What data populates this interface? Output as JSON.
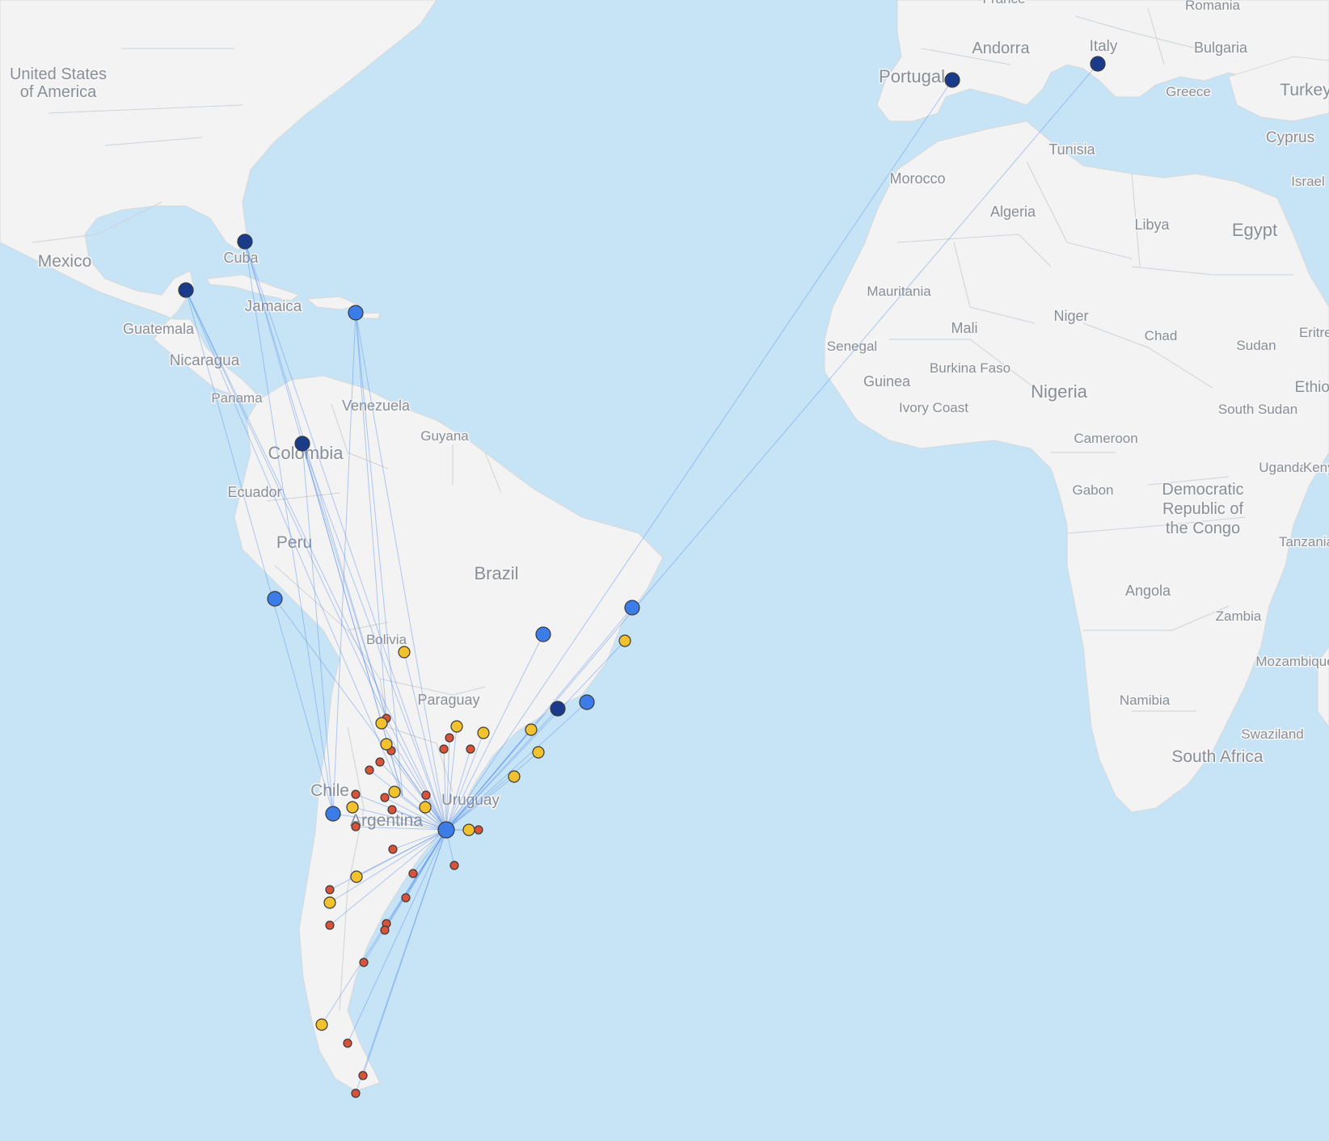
{
  "colors": {
    "ocean": "#c6e4f6",
    "land": "#f3f3f3",
    "route": "#5b8ee8",
    "navy_marker": "#1a3a8a",
    "blue_marker": "#3b7ce8",
    "yellow_marker": "#f2c12e",
    "red_marker": "#d9533b"
  },
  "map": {
    "labels": [
      "United States",
      "of America",
      "Mexico",
      "Cuba",
      "Jamaica",
      "Guatemala",
      "Nicaragua",
      "Panama",
      "Venezuela",
      "Guyana",
      "Colombia",
      "Ecuador",
      "Peru",
      "Brazil",
      "Bolivia",
      "Paraguay",
      "Chile",
      "Uruguay",
      "Argentina",
      "France",
      "Romania",
      "Andorra",
      "Italy",
      "Bulgaria",
      "Portugal",
      "Greece",
      "Turkey",
      "Cyprus",
      "Israel",
      "Tunisia",
      "Morocco",
      "Algeria",
      "Libya",
      "Egypt",
      "Mauritania",
      "Mali",
      "Niger",
      "Chad",
      "Sudan",
      "Senegal",
      "Burkina Faso",
      "Guinea",
      "Ivory Coast",
      "Nigeria",
      "South Sudan",
      "Cameroon",
      "Gabon",
      "Uganda",
      "Democratic",
      "Republic of",
      "the Congo",
      "Tanzania",
      "Angola",
      "Zambia",
      "Mozambique",
      "Namibia",
      "Swaziland",
      "South Africa",
      "Kenya",
      "Eritrea",
      "Ethiopia"
    ]
  },
  "markers": {
    "navy": [
      "Spain",
      "Italy",
      "Florida",
      "Yucatan",
      "Colombia",
      "Sao Paulo"
    ],
    "blue": [
      "Puerto Rico",
      "Lima",
      "Brasilia",
      "Salvador",
      "Rio de Janeiro",
      "Santiago",
      "Buenos Aires"
    ],
    "hub": "Buenos Aires"
  }
}
